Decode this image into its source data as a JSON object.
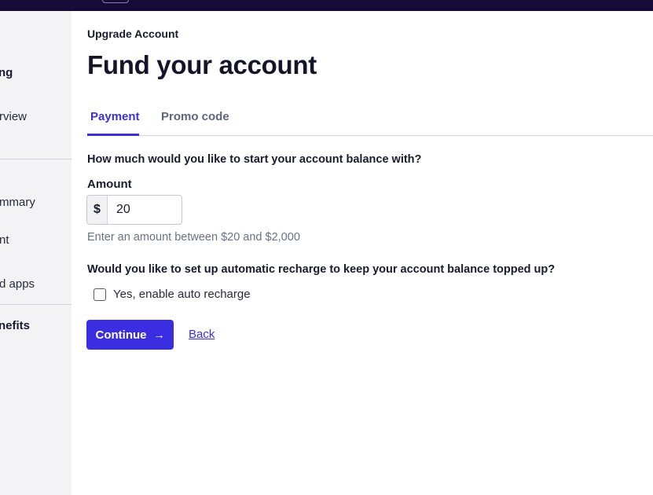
{
  "sidebar": {
    "items": [
      {
        "label": "ng",
        "bold": true
      },
      {
        "label": "rview",
        "bold": false
      },
      {
        "label": "mmary",
        "bold": false
      },
      {
        "label": "nt",
        "bold": false
      },
      {
        "label": "d apps",
        "bold": false
      },
      {
        "label": "nefits",
        "bold": true
      }
    ]
  },
  "page": {
    "eyebrow": "Upgrade Account",
    "title": "Fund your account"
  },
  "tabs": [
    {
      "label": "Payment",
      "active": true
    },
    {
      "label": "Promo code",
      "active": false
    }
  ],
  "form": {
    "amount_question": "How much would you like to start your account balance with?",
    "amount_label": "Amount",
    "currency_symbol": "$",
    "amount_value": "20",
    "amount_hint": "Enter an amount between $20 and $2,000",
    "recharge_question": "Would you like to set up automatic recharge to keep your account balance topped up?",
    "recharge_checkbox_label": "Yes, enable auto recharge",
    "recharge_checked": false
  },
  "actions": {
    "continue_label": "Continue",
    "continue_arrow": "→",
    "back_label": "Back"
  },
  "colors": {
    "accent": "#3b2de0",
    "topbar": "#160a36"
  }
}
